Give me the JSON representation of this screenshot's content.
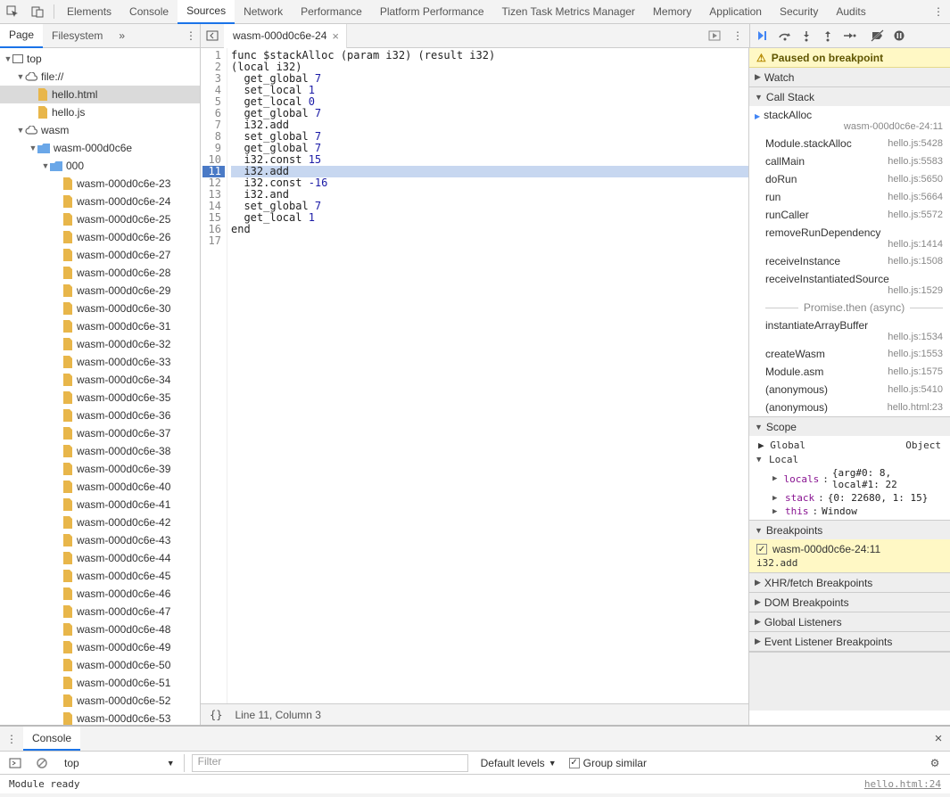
{
  "topTabs": [
    "Elements",
    "Console",
    "Sources",
    "Network",
    "Performance",
    "Platform Performance",
    "Tizen Task Metrics Manager",
    "Memory",
    "Application",
    "Security",
    "Audits"
  ],
  "activeTopTab": "Sources",
  "leftPaneTabs": {
    "page": "Page",
    "filesystem": "Filesystem"
  },
  "openFile": {
    "name": "wasm-000d0c6e-24"
  },
  "tree": {
    "top": "top",
    "fileScheme": "file://",
    "helloHtml": "hello.html",
    "helloJs": "hello.js",
    "wasm": "wasm",
    "wasmFolder": "wasm-000d0c6e",
    "sub": "000",
    "items": [
      "wasm-000d0c6e-23",
      "wasm-000d0c6e-24",
      "wasm-000d0c6e-25",
      "wasm-000d0c6e-26",
      "wasm-000d0c6e-27",
      "wasm-000d0c6e-28",
      "wasm-000d0c6e-29",
      "wasm-000d0c6e-30",
      "wasm-000d0c6e-31",
      "wasm-000d0c6e-32",
      "wasm-000d0c6e-33",
      "wasm-000d0c6e-34",
      "wasm-000d0c6e-35",
      "wasm-000d0c6e-36",
      "wasm-000d0c6e-37",
      "wasm-000d0c6e-38",
      "wasm-000d0c6e-39",
      "wasm-000d0c6e-40",
      "wasm-000d0c6e-41",
      "wasm-000d0c6e-42",
      "wasm-000d0c6e-43",
      "wasm-000d0c6e-44",
      "wasm-000d0c6e-45",
      "wasm-000d0c6e-46",
      "wasm-000d0c6e-47",
      "wasm-000d0c6e-48",
      "wasm-000d0c6e-49",
      "wasm-000d0c6e-50",
      "wasm-000d0c6e-51",
      "wasm-000d0c6e-52",
      "wasm-000d0c6e-53"
    ]
  },
  "code": {
    "hlLine": 11,
    "lines": [
      {
        "n": 1,
        "raw": "func $stackAlloc (param i32) (result i32)"
      },
      {
        "n": 2,
        "raw": "(local i32)"
      },
      {
        "n": 3,
        "raw": "  get_global ",
        "num": "7"
      },
      {
        "n": 4,
        "raw": "  set_local ",
        "num": "1"
      },
      {
        "n": 5,
        "raw": "  get_local ",
        "num": "0"
      },
      {
        "n": 6,
        "raw": "  get_global ",
        "num": "7"
      },
      {
        "n": 7,
        "raw": "  i32.add"
      },
      {
        "n": 8,
        "raw": "  set_global ",
        "num": "7"
      },
      {
        "n": 9,
        "raw": "  get_global ",
        "num": "7"
      },
      {
        "n": 10,
        "raw": "  i32.const ",
        "num": "15"
      },
      {
        "n": 11,
        "raw": "  i32.add"
      },
      {
        "n": 12,
        "raw": "  i32.const ",
        "num": "-16"
      },
      {
        "n": 13,
        "raw": "  i32.and"
      },
      {
        "n": 14,
        "raw": "  set_global ",
        "num": "7"
      },
      {
        "n": 15,
        "raw": "  get_local ",
        "num": "1"
      },
      {
        "n": 16,
        "raw": "end"
      },
      {
        "n": 17,
        "raw": ""
      }
    ]
  },
  "editorFooter": "Line 11, Column 3",
  "paused": "Paused on breakpoint",
  "panels": {
    "watch": "Watch",
    "callstack": "Call Stack",
    "scope": "Scope",
    "breakpoints": "Breakpoints",
    "xhr": "XHR/fetch Breakpoints",
    "dom": "DOM Breakpoints",
    "global": "Global Listeners",
    "event": "Event Listener Breakpoints"
  },
  "callstack": [
    {
      "name": "stackAlloc",
      "loc": "wasm-000d0c6e-24:11",
      "current": true,
      "twoLine": true
    },
    {
      "name": "Module.stackAlloc",
      "loc": "hello.js:5428"
    },
    {
      "name": "callMain",
      "loc": "hello.js:5583"
    },
    {
      "name": "doRun",
      "loc": "hello.js:5650"
    },
    {
      "name": "run",
      "loc": "hello.js:5664"
    },
    {
      "name": "runCaller",
      "loc": "hello.js:5572"
    },
    {
      "name": "removeRunDependency",
      "loc": "hello.js:1414",
      "twoLine": true
    },
    {
      "name": "receiveInstance",
      "loc": "hello.js:1508"
    },
    {
      "name": "receiveInstantiatedSource",
      "loc": "hello.js:1529",
      "twoLine": true
    }
  ],
  "asyncLabel": "Promise.then (async)",
  "callstack2": [
    {
      "name": "instantiateArrayBuffer",
      "loc": "hello.js:1534",
      "twoLine": true
    },
    {
      "name": "createWasm",
      "loc": "hello.js:1553"
    },
    {
      "name": "Module.asm",
      "loc": "hello.js:1575"
    },
    {
      "name": "(anonymous)",
      "loc": "hello.js:5410"
    },
    {
      "name": "(anonymous)",
      "loc": "hello.html:23"
    }
  ],
  "scope": {
    "globalLabel": "Global",
    "globalType": "Object",
    "localLabel": "Local",
    "locals": {
      "label": "locals",
      "body": "{arg#0: 8, local#1: 22"
    },
    "stack": {
      "label": "stack",
      "body": "{0: 22680, 1: 15}"
    },
    "this": {
      "label": "this",
      "body": "Window"
    }
  },
  "breakpoints": {
    "label": "wasm-000d0c6e-24:11",
    "code": "i32.add"
  },
  "console": {
    "tab": "Console",
    "context": "top",
    "filterPlaceholder": "Filter",
    "levels": "Default levels",
    "group": "Group similar",
    "msg": "Module ready",
    "src": "hello.html:24"
  }
}
